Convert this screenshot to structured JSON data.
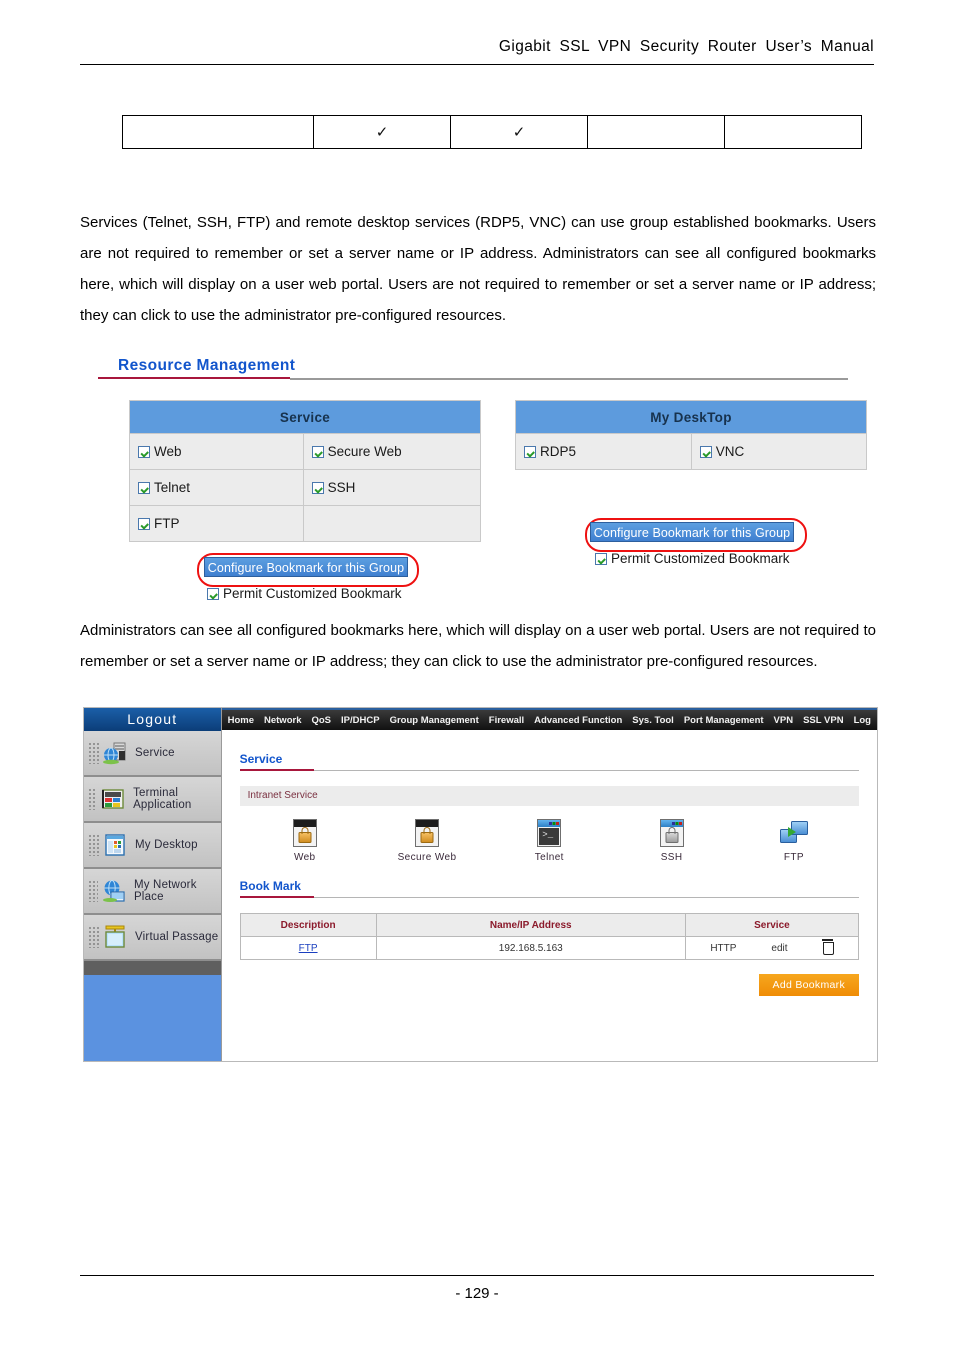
{
  "document": {
    "header_title": "Gigabit SSL VPN Security Router User’s Manual",
    "page_number": "- 129 -"
  },
  "top_table": {
    "cells": [
      "",
      "✓",
      "✓",
      "",
      ""
    ]
  },
  "paragraphs": {
    "p1": " Services (Telnet, SSH, FTP) and remote desktop services (RDP5, VNC) can use group established bookmarks. Users are not required to remember or set a server name or IP address.\n Administrators can see all configured bookmarks here, which will display on a user web portal. Users are not required to remember or set a server name or IP address; they can click to use the administrator pre-configured resources.",
    "p2": " Administrators can see all configured bookmarks here, which will display on a user web portal. Users are not required to remember or set a server name or IP address; they can click to use the administrator pre-configured resources."
  },
  "resource_management": {
    "heading": "Resource Management"
  },
  "service_table": {
    "header": "Service",
    "rows": [
      {
        "left": "Web",
        "right": "Secure Web"
      },
      {
        "left": "Telnet",
        "right": "SSH"
      },
      {
        "left": "FTP",
        "right": ""
      }
    ]
  },
  "desktop_table": {
    "header": "My DeskTop",
    "rows": [
      {
        "left": "RDP5",
        "right": "VNC"
      }
    ]
  },
  "configure_left": {
    "button_label": "Configure Bookmark for this Group",
    "permit_label": "Permit Customized Bookmark"
  },
  "configure_right": {
    "button_label": "Configure Bookmark for this Group",
    "permit_label": "Permit Customized Bookmark"
  },
  "router_ui": {
    "sidebar": {
      "logout_label": "Logout",
      "items": [
        {
          "label": "Service",
          "icon": "globe-server-icon"
        },
        {
          "label": "Terminal Application",
          "icon": "terminal-app-icon"
        },
        {
          "label": "My Desktop",
          "icon": "desktop-icon"
        },
        {
          "label": "My Network Place",
          "icon": "network-place-icon"
        },
        {
          "label": "Virtual Passage",
          "icon": "virtual-passage-icon"
        }
      ]
    },
    "nav": [
      "Home",
      "Network",
      "QoS",
      "IP/DHCP",
      "Group Management",
      "Firewall",
      "Advanced Function",
      "Sys. Tool",
      "Port Management",
      "VPN",
      "SSL VPN",
      "Log"
    ],
    "service_section": {
      "title": "Service",
      "subbar": "Intranet Service",
      "icons": [
        {
          "label": "Web",
          "icon": "web-lock-icon"
        },
        {
          "label": "Secure Web",
          "icon": "secure-web-lock-icon"
        },
        {
          "label": "Telnet",
          "icon": "telnet-terminal-icon"
        },
        {
          "label": "SSH",
          "icon": "ssh-lock-icon"
        },
        {
          "label": "FTP",
          "icon": "ftp-monitors-icon"
        }
      ]
    },
    "bookmark_section": {
      "title": "Book Mark",
      "columns": [
        "Description",
        "Name/IP Address",
        "Service"
      ],
      "rows": [
        {
          "description": "FTP",
          "address": "192.168.5.163",
          "service": "HTTP",
          "edit_label": "edit",
          "delete_icon": "trash-icon"
        }
      ],
      "add_button": "Add Bookmark"
    }
  },
  "colors": {
    "heading_blue": "#1255cc",
    "rule_red": "#a8173c",
    "table_header_blue": "#5d9bdd",
    "annotation_red": "#ee1111",
    "button_blue": "#3f7fd0",
    "add_button_orange": "#ef8c06"
  }
}
